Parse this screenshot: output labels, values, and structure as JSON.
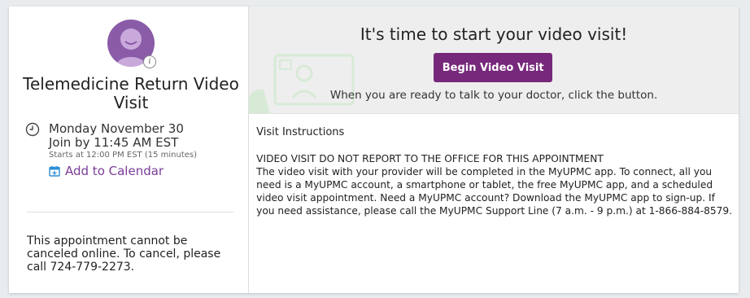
{
  "visit": {
    "title": "Telemedicine Return Video Visit",
    "date": "Monday November 30",
    "join_by": "Join by 11:45 AM EST",
    "starts_at": "Starts at 12:00 PM EST (15 minutes)",
    "add_to_calendar": "Add to Calendar",
    "cancel_note": "This appointment cannot be canceled online. To cancel, please call 724-779-2273."
  },
  "banner": {
    "title": "It's time to start your video visit!",
    "button_label": "Begin Video Visit",
    "subtitle": "When you are ready to talk to your doctor, click the button."
  },
  "instructions": {
    "heading": "Visit Instructions",
    "lines": [
      "VIDEO VISIT DO NOT REPORT TO THE OFFICE FOR THIS APPOINTMENT",
      "The video visit with your provider will be completed in the MyUPMC app. To connect, all you",
      "need is a MyUPMC account, a smartphone or tablet, the free MyUPMC app, and a scheduled",
      "video visit appointment. Need a MyUPMC account? Download the MyUPMC app to sign-up. If",
      "you need assistance, please call the MyUPMC Support Line (7 a.m. - 9 p.m.) at 1-866-884-8579."
    ]
  },
  "colors": {
    "accent_purple": "#76287a",
    "avatar_purple": "#8a5ca8",
    "link_purple": "#7a3c98",
    "banner_bg": "#eeeeee"
  }
}
